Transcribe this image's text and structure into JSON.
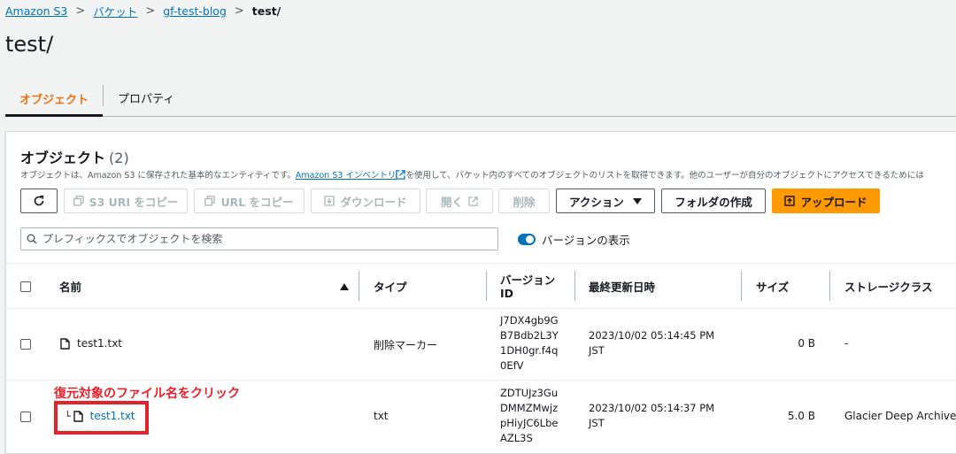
{
  "breadcrumb": {
    "items": [
      "Amazon S3",
      "バケット",
      "gf-test-blog"
    ],
    "current": "test/"
  },
  "page": {
    "title": "test/"
  },
  "tabs": [
    {
      "label": "オブジェクト",
      "active": true
    },
    {
      "label": "プロパティ",
      "active": false
    }
  ],
  "objects_panel": {
    "heading": "オブジェクト",
    "count": "(2)",
    "desc_before": "オブジェクトは、Amazon S3 に保存された基本的なエンティティです。",
    "desc_link": "Amazon S3 インベントリ",
    "desc_after": "を使用して、バケット内のすべてのオブジェクトのリストを取得できます。他のユーザーが自分のオブジェクトにアクセスできるためには"
  },
  "toolbar": {
    "copy_s3_uri": "S3 URI をコピー",
    "copy_url": "URL をコピー",
    "download": "ダウンロード",
    "open": "開く",
    "delete": "削除",
    "actions": "アクション",
    "create_folder": "フォルダの作成",
    "upload": "アップロード"
  },
  "search": {
    "placeholder": "プレフィックスでオブジェクトを検索"
  },
  "version_toggle": {
    "label": "バージョンの表示",
    "on": true
  },
  "table": {
    "headers": {
      "name": "名前",
      "type": "タイプ",
      "version_id_1": "バージョン",
      "version_id_2": "ID",
      "last_modified": "最終更新日時",
      "size": "サイズ",
      "storage_class": "ストレージクラス"
    },
    "rows": [
      {
        "name": "test1.txt",
        "type": "削除マーカー",
        "version_lines": [
          "J7DX4gb9G",
          "B7Bdb2L3Y",
          "1DH0gr.f4q",
          "0EfV"
        ],
        "date_line1": "2023/10/02 05:14:45 PM",
        "date_line2": "JST",
        "size": "0 B",
        "storage_class": "-"
      },
      {
        "name": "test1.txt",
        "type": "txt",
        "version_lines": [
          "ZDTUJz3Gu",
          "DMMZMwjz",
          "pHiyJC6Lbe",
          "AZL3S"
        ],
        "date_line1": "2023/10/02 05:14:37 PM",
        "date_line2": "JST",
        "size": "5.0 B",
        "storage_class": "Glacier Deep Archive"
      }
    ]
  },
  "annotation": {
    "text": "復元対象のファイル名をクリック",
    "color": "#e8202a"
  },
  "colors": {
    "accent": "#ec7211",
    "link": "#0073bb",
    "primary_button": "#ff9900"
  }
}
